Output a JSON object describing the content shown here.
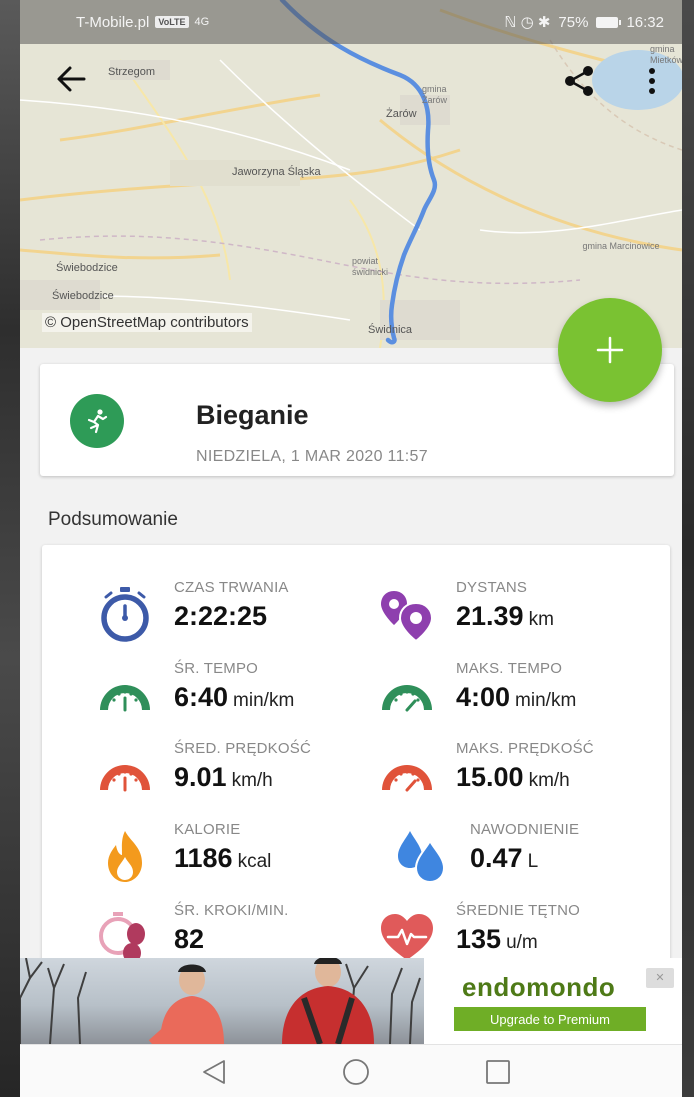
{
  "status_bar": {
    "carrier": "T-Mobile.pl",
    "volte_badge": "VoLTE",
    "network": "4G",
    "status_icons": "ℕ ◷ ✱",
    "battery": "75%",
    "time": "16:32"
  },
  "map": {
    "attribution": "© OpenStreetMap contributors",
    "labels": {
      "strzegom": "Strzegom",
      "gmina_zarow": "gmina Żarów",
      "zarow": "Żarów",
      "jaworzyna": "Jaworzyna Śląska",
      "powiat": "powiat świdnicki",
      "swiebodzice1": "Świebodzice",
      "swiebodzice2": "Świebodzice",
      "gmina_marcinowice": "gmina Marcinowice",
      "swidnica": "Świdnica",
      "gmina_mietkow": "gmina Mietków"
    }
  },
  "activity": {
    "title": "Bieganie",
    "date": "NIEDZIELA, 1 MAR 2020 11:57"
  },
  "summary": {
    "title": "Podsumowanie",
    "stats": [
      {
        "label": "CZAS TRWANIA",
        "value": "2:22:25",
        "unit": "",
        "icon": "stopwatch-icon"
      },
      {
        "label": "DYSTANS",
        "value": "21.39",
        "unit": "km",
        "icon": "route-pins-icon"
      },
      {
        "label": "ŚR. TEMPO",
        "value": "6:40",
        "unit": "min/km",
        "icon": "speedometer-icon"
      },
      {
        "label": "MAKS. TEMPO",
        "value": "4:00",
        "unit": "min/km",
        "icon": "speedometer-icon"
      },
      {
        "label": "ŚRED. PRĘDKOŚĆ",
        "value": "9.01",
        "unit": "km/h",
        "icon": "speedometer-icon"
      },
      {
        "label": "MAKS. PRĘDKOŚĆ",
        "value": "15.00",
        "unit": "km/h",
        "icon": "speedometer-icon"
      },
      {
        "label": "KALORIE",
        "value": "1186",
        "unit": "kcal",
        "icon": "flame-icon"
      },
      {
        "label": "NAWODNIENIE",
        "value": "0.47",
        "unit": "L",
        "icon": "water-drops-icon"
      },
      {
        "label": "ŚR. KROKI/MIN.",
        "value": "82",
        "unit": "",
        "icon": "cadence-icon"
      },
      {
        "label": "ŚREDNIE TĘTNO",
        "value": "135",
        "unit": "u/m",
        "icon": "heart-rate-icon"
      }
    ]
  },
  "ad": {
    "brand": "endomondo",
    "cta": "Upgrade to Premium",
    "close_label": "✕"
  },
  "colors": {
    "accent_green": "#7ac232",
    "activity_green": "#2e9b57",
    "route_blue": "#5b8fe0",
    "stopwatch_blue": "#3d5aa8",
    "distance_purple": "#8e3fae",
    "pace_green": "#2f8f5a",
    "speed_red": "#e0533a",
    "flame_orange": "#f39a1d",
    "water_blue": "#3f86e0",
    "cadence_pink": "#b03a5e",
    "heart_red": "#e05a5a"
  }
}
